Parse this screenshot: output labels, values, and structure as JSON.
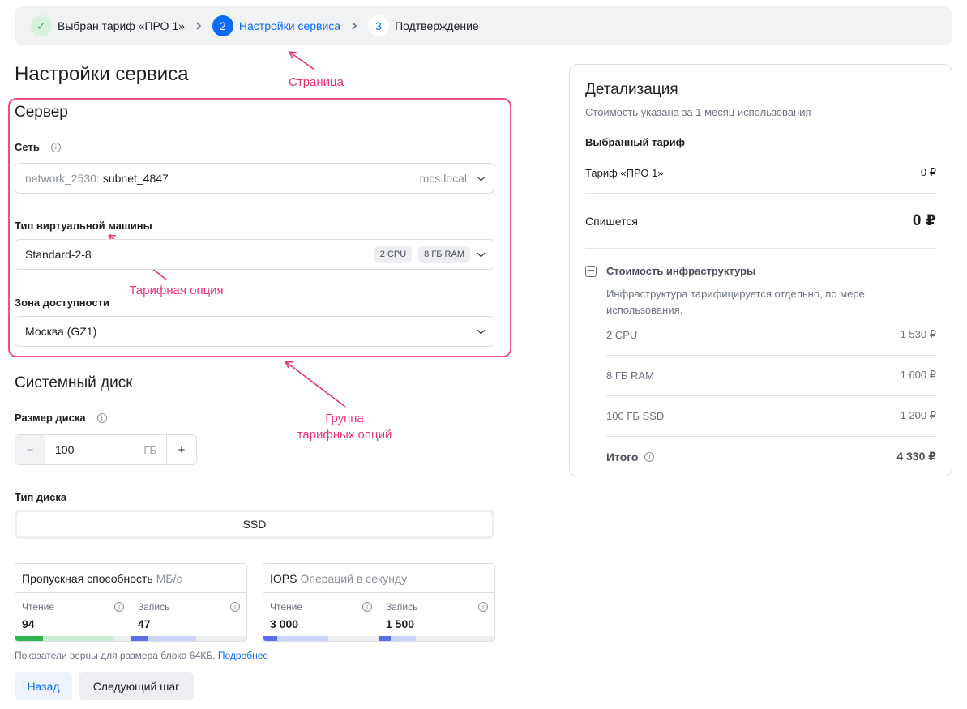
{
  "stepper": {
    "steps": [
      {
        "label": "Выбран тариф «ПРО 1»",
        "num": "✓",
        "state": "done"
      },
      {
        "label": "Настройки сервиса",
        "num": "2",
        "state": "active"
      },
      {
        "label": "Подтверждение",
        "num": "3",
        "state": "todo"
      }
    ]
  },
  "page": {
    "title": "Настройки сервиса"
  },
  "annotations": {
    "page": "Страница",
    "option": "Тарифная опция",
    "group_line1": "Группа",
    "group_line2": "тарифных опций"
  },
  "server": {
    "title": "Сервер",
    "network": {
      "label": "Сеть",
      "prefix": "network_2530:",
      "value": "subnet_4847",
      "suffix": "mcs.local"
    },
    "vm": {
      "label": "Тип виртуальной машины",
      "value": "Standard-2-8",
      "chips": [
        "2 CPU",
        "8 ГБ RAM"
      ]
    },
    "zone": {
      "label": "Зона доступности",
      "value": "Москва (GZ1)"
    }
  },
  "disk": {
    "title": "Системный диск",
    "size_label": "Размер диска",
    "minus": "−",
    "plus": "+",
    "size_value": "100",
    "size_unit": "ГБ",
    "type_label": "Тип диска",
    "type_value": "SSD",
    "throughput": {
      "title": "Пропускная способность",
      "unit": "МБ/с",
      "read_label": "Чтение",
      "read_value": "94",
      "write_label": "Запись",
      "write_value": "47"
    },
    "iops": {
      "title": "IOPS",
      "unit": "Операций в секунду",
      "read_label": "Чтение",
      "read_value": "3 000",
      "write_label": "Запись",
      "write_value": "1 500"
    },
    "footnote": "Показатели верны для размера блока 64КБ.",
    "footnote_link": "Подробнее"
  },
  "buttons": {
    "back": "Назад",
    "next": "Следующий шаг"
  },
  "summary": {
    "title": "Детализация",
    "subtitle": "Стоимость указана за 1 месяц использования",
    "tariff_label": "Выбранный тариф",
    "tariff_name": "Тариф «ПРО 1»",
    "tariff_price": "0 ₽",
    "charge_label": "Спишется",
    "charge_value": "0 ₽",
    "infra_title": "Стоимость инфраструктуры",
    "infra_desc": "Инфраструктура тарифицируется отдельно, по мере использования.",
    "infra_rows": [
      {
        "name": "2 CPU",
        "price": "1 530 ₽"
      },
      {
        "name": "8 ГБ RAM",
        "price": "1 600 ₽"
      },
      {
        "name": "100 ГБ SSD",
        "price": "1 200 ₽"
      }
    ],
    "total_label": "Итого",
    "total_value": "4 330 ₽"
  },
  "colors": {
    "accent": "#0a6cf5",
    "annotation": "#e8337a",
    "read_bar": "#2eb350",
    "write_bar": "#5b6ef0"
  }
}
